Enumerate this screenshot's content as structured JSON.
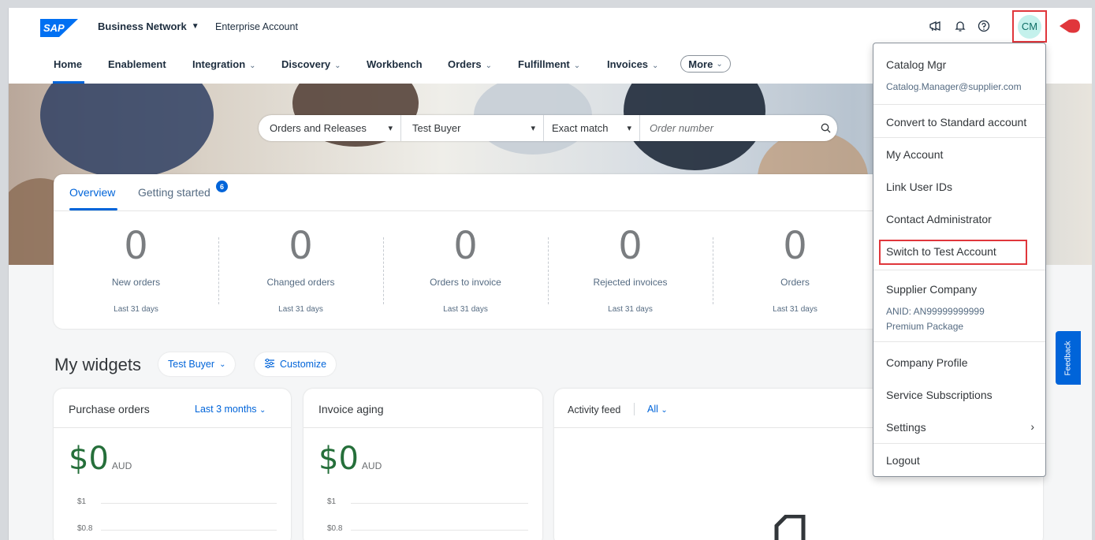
{
  "header": {
    "logo_text": "SAP",
    "brand": "Business Network",
    "account_type": "Enterprise Account",
    "avatar_initials": "CM"
  },
  "nav": {
    "items": [
      {
        "label": "Home",
        "dropdown": false
      },
      {
        "label": "Enablement",
        "dropdown": false
      },
      {
        "label": "Integration",
        "dropdown": true
      },
      {
        "label": "Discovery",
        "dropdown": true
      },
      {
        "label": "Workbench",
        "dropdown": false
      },
      {
        "label": "Orders",
        "dropdown": true
      },
      {
        "label": "Fulfillment",
        "dropdown": true
      },
      {
        "label": "Invoices",
        "dropdown": true
      }
    ],
    "more_label": "More",
    "active": "Home"
  },
  "search": {
    "doc_type": "Orders and Releases",
    "buyer": "Test Buyer",
    "match": "Exact match",
    "placeholder": "Order number"
  },
  "overview": {
    "tabs": {
      "overview": "Overview",
      "getting_started": "Getting started",
      "getting_started_badge": "6"
    },
    "stats": [
      {
        "value": "0",
        "label": "New orders",
        "period": "Last 31 days"
      },
      {
        "value": "0",
        "label": "Changed orders",
        "period": "Last 31 days"
      },
      {
        "value": "0",
        "label": "Orders to invoice",
        "period": "Last 31 days"
      },
      {
        "value": "0",
        "label": "Rejected invoices",
        "period": "Last 31 days"
      },
      {
        "value": "0",
        "label": "Orders",
        "period": "Last 31 days"
      }
    ]
  },
  "widgets": {
    "title": "My widgets",
    "buyer_filter": "Test Buyer",
    "customize_label": "Customize",
    "purchase_orders": {
      "title": "Purchase orders",
      "range": "Last 3 months",
      "value": "$0",
      "currency": "AUD",
      "axis": [
        "$1",
        "$0.8"
      ]
    },
    "invoice_aging": {
      "title": "Invoice aging",
      "value": "$0",
      "currency": "AUD",
      "axis": [
        "$1",
        "$0.8"
      ]
    },
    "activity_feed": {
      "title": "Activity feed",
      "filter": "All"
    }
  },
  "user_menu": {
    "name": "Catalog Mgr",
    "email": "Catalog.Manager@supplier.com",
    "convert": "Convert to Standard account",
    "my_account": "My Account",
    "link_user_ids": "Link User IDs",
    "contact_admin": "Contact Administrator",
    "switch_test": "Switch to Test Account",
    "company": "Supplier Company",
    "anid": "ANID: AN99999999999",
    "package": "Premium Package",
    "company_profile": "Company Profile",
    "service_subscriptions": "Service Subscriptions",
    "settings": "Settings",
    "logout": "Logout"
  },
  "feedback_label": "Feedback",
  "colors": {
    "accent": "#0064d9",
    "highlight": "#e0363b",
    "money": "#256f3a",
    "avatar_bg": "#c4f1ec"
  }
}
